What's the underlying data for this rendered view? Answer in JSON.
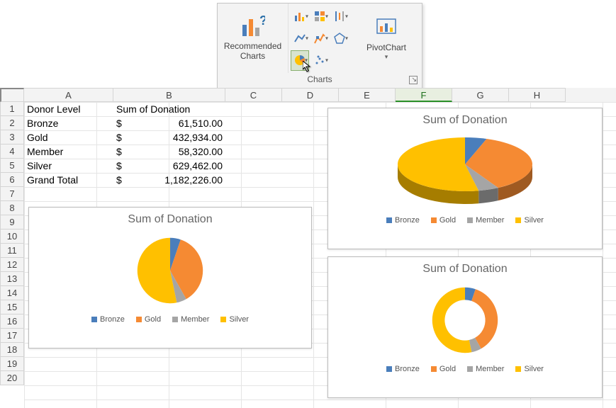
{
  "ribbon": {
    "recommended": "Recommended\nCharts",
    "pivotchart": "PivotChart",
    "group_label": "Charts"
  },
  "columns": [
    "A",
    "B",
    "C",
    "D",
    "E",
    "F",
    "G",
    "H"
  ],
  "selected_col": "F",
  "row_count": 20,
  "table": {
    "rows": [
      {
        "label": "Donor Level",
        "value_label": "Sum of Donation"
      },
      {
        "label": "Bronze",
        "dollar": "$",
        "value": "61,510.00"
      },
      {
        "label": "Gold",
        "dollar": "$",
        "value": "432,934.00"
      },
      {
        "label": "Member",
        "dollar": "$",
        "value": "58,320.00"
      },
      {
        "label": "Silver",
        "dollar": "$",
        "value": "629,462.00"
      },
      {
        "label": "Grand Total",
        "dollar": "$",
        "value": "1,182,226.00"
      }
    ]
  },
  "legend_items": [
    "Bronze",
    "Gold",
    "Member",
    "Silver"
  ],
  "chart1": {
    "title": "Sum of Donation"
  },
  "chart2": {
    "title": "Sum of Donation"
  },
  "chart3": {
    "title": "Sum of Donation"
  },
  "chart_data": {
    "type": "pie",
    "title": "Sum of Donation",
    "categories": [
      "Bronze",
      "Gold",
      "Member",
      "Silver"
    ],
    "values": [
      61510,
      432934,
      58320,
      629462
    ],
    "series": [
      {
        "name": "Sum of Donation",
        "values": [
          61510,
          432934,
          58320,
          629462
        ]
      }
    ],
    "colors": {
      "Bronze": "#4a7ebb",
      "Gold": "#f58a33",
      "Member": "#a5a5a5",
      "Silver": "#ffc000"
    },
    "total": 1182226,
    "variants": [
      "pie-2d",
      "pie-3d",
      "doughnut"
    ]
  }
}
